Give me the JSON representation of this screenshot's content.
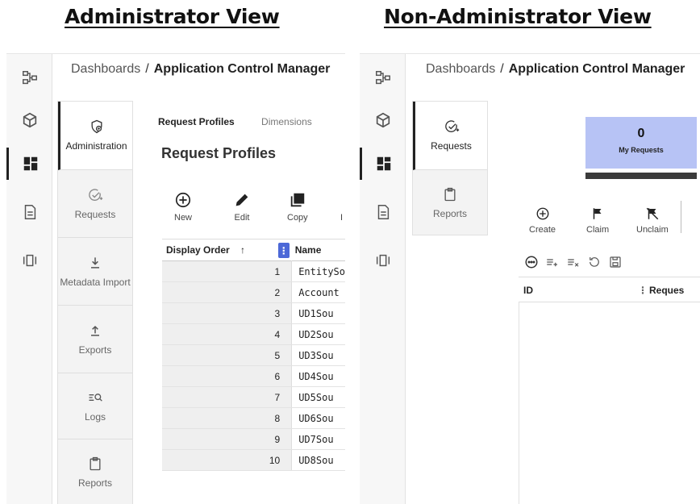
{
  "headings": {
    "left": "Administrator View",
    "right": "Non-Administrator View"
  },
  "breadcrumb": {
    "root": "Dashboards",
    "separator": "/",
    "current": "Application Control Manager"
  },
  "rail_icons": [
    "hierarchy-icon",
    "cube-icon",
    "dashboard-icon",
    "document-icon",
    "panels-icon"
  ],
  "admin": {
    "subnav": [
      {
        "label": "Administration",
        "icon": "shield-gear-icon",
        "active": true
      },
      {
        "label": "Requests",
        "icon": "check-plus-icon",
        "active": false
      },
      {
        "label": "Metadata Import",
        "icon": "download-icon",
        "active": false
      },
      {
        "label": "Exports",
        "icon": "upload-icon",
        "active": false
      },
      {
        "label": "Logs",
        "icon": "search-list-icon",
        "active": false
      },
      {
        "label": "Reports",
        "icon": "clipboard-icon",
        "active": false
      }
    ],
    "tabs": [
      {
        "label": "Request Profiles",
        "active": true
      },
      {
        "label": "Dimensions",
        "active": false
      }
    ],
    "section_title": "Request Profiles",
    "toolbar": [
      {
        "label": "New",
        "icon": "plus-circle-icon"
      },
      {
        "label": "Edit",
        "icon": "pencil-icon"
      },
      {
        "label": "Copy",
        "icon": "copy-icon"
      },
      {
        "label": "I",
        "icon": ""
      }
    ],
    "grid": {
      "columns": [
        "Display Order",
        "Name"
      ],
      "sort_indicator": "↑",
      "menu_glyph": "⋮",
      "rows": [
        {
          "order": "1",
          "name": "EntitySo"
        },
        {
          "order": "2",
          "name": "Account"
        },
        {
          "order": "3",
          "name": "UD1Sou"
        },
        {
          "order": "4",
          "name": "UD2Sou"
        },
        {
          "order": "5",
          "name": "UD3Sou"
        },
        {
          "order": "6",
          "name": "UD4Sou"
        },
        {
          "order": "7",
          "name": "UD5Sou"
        },
        {
          "order": "8",
          "name": "UD6Sou"
        },
        {
          "order": "9",
          "name": "UD7Sou"
        },
        {
          "order": "10",
          "name": "UD8Sou"
        }
      ]
    }
  },
  "nonadmin": {
    "subnav": [
      {
        "label": "Requests",
        "icon": "check-plus-icon",
        "active": true
      },
      {
        "label": "Reports",
        "icon": "clipboard-icon",
        "active": false
      }
    ],
    "metric": {
      "value": "0",
      "label": "My Requests",
      "color": "#b7c3f5"
    },
    "toolbar": [
      {
        "label": "Create",
        "icon": "plus-circle-icon"
      },
      {
        "label": "Claim",
        "icon": "flag-icon"
      },
      {
        "label": "Unclaim",
        "icon": "flag-off-icon"
      }
    ],
    "filter_icons": [
      "more-circle-icon",
      "add-filter-icon",
      "clear-filter-icon",
      "refresh-icon",
      "save-icon"
    ],
    "grid": {
      "columns": [
        "ID",
        "Reques"
      ],
      "menu_glyph": "⋮"
    }
  },
  "colors": {
    "accent": "#4c68d7",
    "metric_bar": "#3b3b3b",
    "rail_bg": "#f7f7f7"
  }
}
